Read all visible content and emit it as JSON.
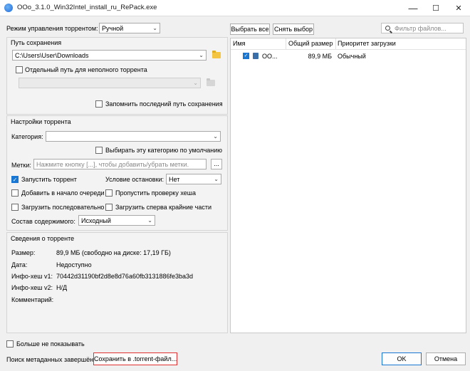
{
  "window": {
    "title": "OOo_3.1.0_Win32Intel_install_ru_RePack.exe",
    "minimize": "—",
    "maximize": "☐",
    "close": "✕"
  },
  "torrent_mode": {
    "label": "Режим управления торрентом:",
    "value": "Ручной"
  },
  "save_path": {
    "title": "Путь сохранения",
    "path": "C:\\Users\\User\\Downloads",
    "separate_path_label": "Отдельный путь для неполного торрента",
    "separate_path_value": "",
    "remember_label": "Запомнить последний путь сохранения"
  },
  "torrent_settings": {
    "title": "Настройки торрента",
    "category_label": "Категория:",
    "category_value": "",
    "default_category_label": "Выбирать эту категорию по умолчанию",
    "tags_label": "Метки:",
    "tags_placeholder": "Нажмите кнопку [...], чтобы добавить/убрать метки.",
    "tags_button": "...",
    "start_torrent_label": "Запустить торрент",
    "stop_condition_label": "Условие остановки:",
    "stop_condition_value": "Нет",
    "add_top_label": "Добавить в начало очереди",
    "skip_hash_label": "Пропустить проверку хеша",
    "sequential_label": "Загрузить последовательно",
    "first_last_label": "Загрузить сперва крайние части",
    "layout_label": "Состав содержимого:",
    "layout_value": "Исходный"
  },
  "info": {
    "title": "Сведения о торренте",
    "rows": [
      {
        "label": "Размер:",
        "value": "89,9 МБ (свободно на диске: 17,19 ГБ)"
      },
      {
        "label": "Дата:",
        "value": "Недоступно"
      },
      {
        "label": "Инфо-хеш v1:",
        "value": "70442d31190bf2d8e8d76a60fb3131886fe3ba3d"
      },
      {
        "label": "Инфо-хеш v2:",
        "value": "Н/Д"
      },
      {
        "label": "Комментарий:",
        "value": ""
      }
    ]
  },
  "files": {
    "select_all": "Выбрать все",
    "select_none": "Снять выбор",
    "filter_placeholder": "Фильтр файлов...",
    "columns": [
      "Имя",
      "Общий размер",
      "Приоритет загрузки"
    ],
    "rows": [
      {
        "name": "OO...",
        "size": "89,9 МБ",
        "priority": "Обычный"
      }
    ]
  },
  "footer": {
    "dont_show": "Больше не показывать",
    "status": "Поиск метаданных завершён",
    "save_torrent": "Сохранить в .torrent-файл...",
    "ok": "OK",
    "cancel": "Отмена"
  },
  "colors": {
    "accent": "#1976d2",
    "highlight_border": "#e03030",
    "folder": "#f4c542"
  }
}
